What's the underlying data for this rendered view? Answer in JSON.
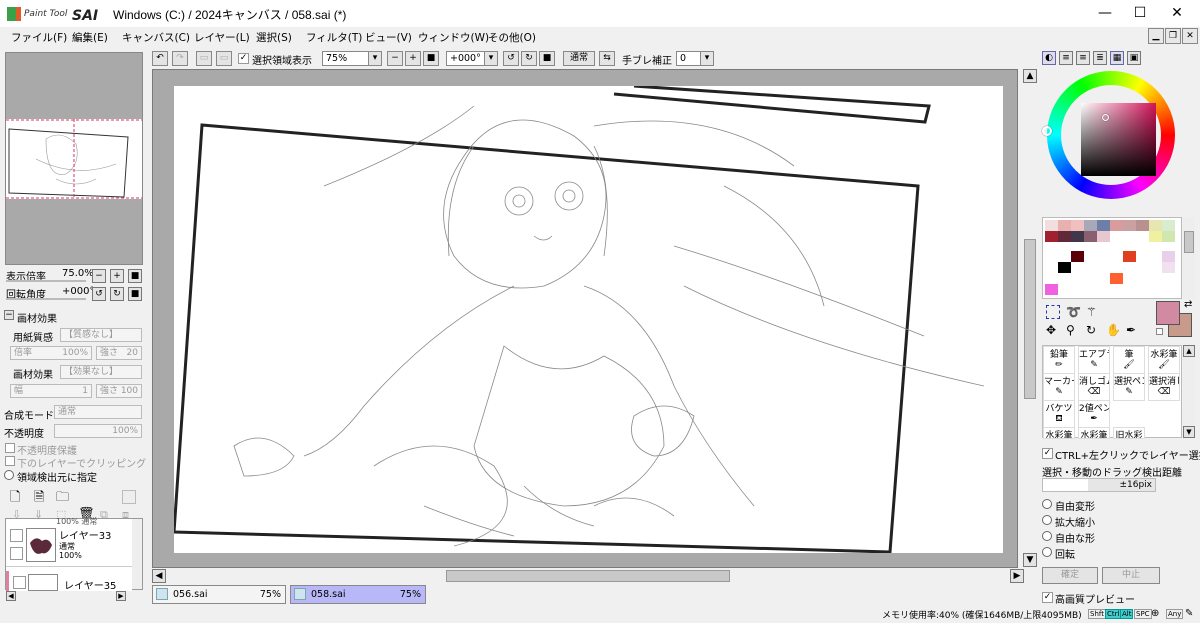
{
  "app": {
    "logo_small": "Paint Tool",
    "logo_big": "SAI",
    "title": "Windows (C:) / 2024キャンバス / 058.sai (*)"
  },
  "window_buttons": {
    "minimize": "—",
    "maximize": "☐",
    "close": "✕"
  },
  "menu": [
    "ファイル(F)",
    "編集(E)",
    "キャンバス(C)",
    "レイヤー(L)",
    "選択(S)",
    "フィルタ(T)",
    "ビュー(V)",
    "ウィンドウ(W)",
    "その他(O)"
  ],
  "left": {
    "zoom_label": "表示倍率",
    "zoom_value": "75.0%",
    "rotate_label": "回転角度",
    "rotate_value": "+000°",
    "texture_header": "画材効果",
    "paper_label": "用紙質感",
    "paper_value": "【質感なし】",
    "scale_label": "倍率",
    "scale_value": "100%",
    "strength_label": "強さ",
    "strength_value": "20",
    "effect_label": "画材効果",
    "effect_value": "【効果なし】",
    "width_label": "幅",
    "width_value": "1",
    "strength2_label": "強さ",
    "strength2_value": "100",
    "blend_label": "合成モード",
    "blend_value": "通常",
    "opacity_label": "不透明度",
    "opacity_value": "100%",
    "preserve_opacity": "不透明度保護",
    "clip_below": "下のレイヤーでクリッピング",
    "selection_source": "領域検出元に指定",
    "layer_partial": "100% 通常",
    "layers": [
      {
        "name": "レイヤー33",
        "mode": "通常",
        "opacity": "100%"
      },
      {
        "name": "レイヤー35"
      }
    ]
  },
  "toolbar": {
    "show_selection": "選択領域表示",
    "zoom": "75%",
    "rotation": "+000°",
    "blend": "通常",
    "stabilizer_label": "手ブレ補正",
    "stabilizer_value": "0"
  },
  "tabs": [
    {
      "name": "056.sai",
      "zoom": "75%"
    },
    {
      "name": "058.sai",
      "zoom": "75%"
    }
  ],
  "right": {
    "tools": [
      [
        "鉛筆",
        "エアブラシ",
        "筆",
        "水彩筆"
      ],
      [
        "マーカー",
        "消しゴム",
        "選択ペン",
        "選択消し"
      ],
      [
        "バケツ",
        "2値ペン",
        "",
        ""
      ],
      [
        "水彩筆",
        "水彩筆",
        "旧水彩",
        ""
      ]
    ],
    "ctrl_click": "CTRL+左クリックでレイヤー選択",
    "drag_label": "選択・移動のドラッグ検出距離",
    "drag_value": "±16pix",
    "transform_options": [
      "自由変形",
      "拡大縮小",
      "自由な形",
      "回転"
    ],
    "confirm": "確定",
    "cancel": "中止",
    "hq_preview": "高画質プレビュー"
  },
  "status": {
    "memory": "メモリ使用率:40% (確保1646MB/上限4095MB)",
    "keys": [
      "Shft",
      "Ctrl",
      "Alt",
      "SPC",
      "Any"
    ]
  },
  "colors": {
    "primary": "#d18aa2",
    "secondary": "#c89a8c",
    "tab_active": "#b8b8f8",
    "accent": "#e0e0ff"
  }
}
